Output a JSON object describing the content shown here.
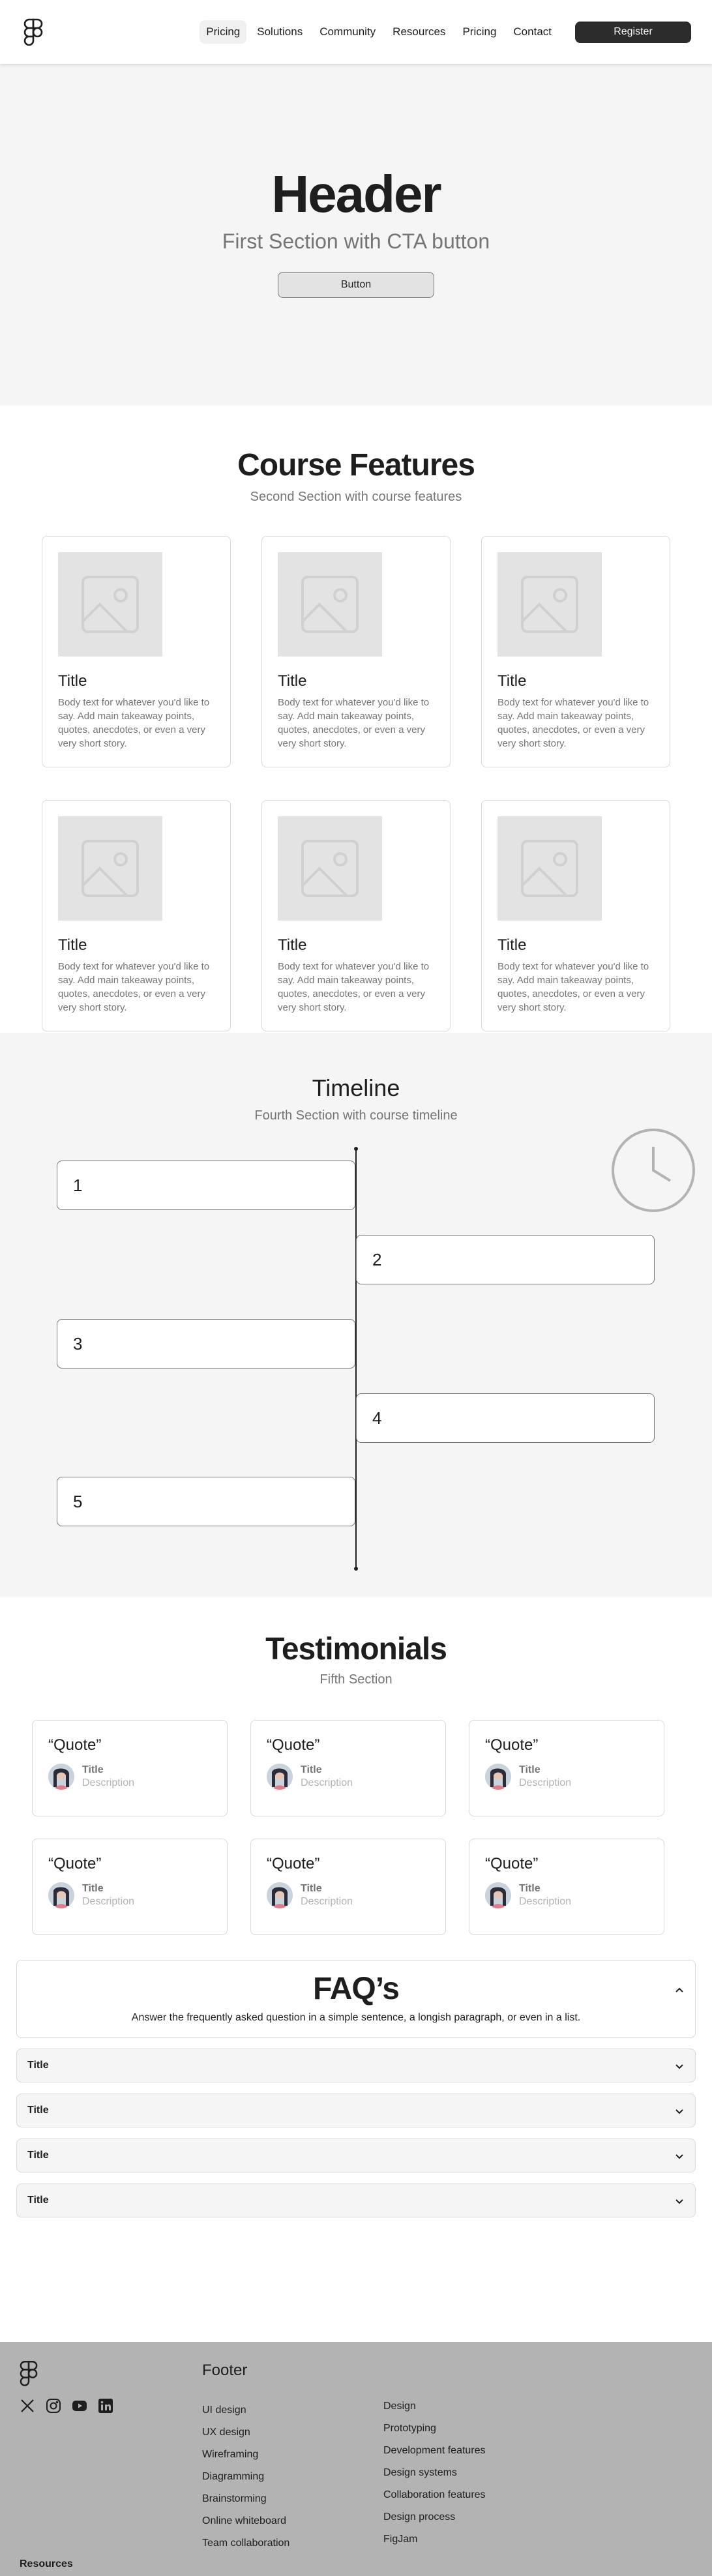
{
  "nav": {
    "links": [
      "Pricing",
      "Solutions",
      "Community",
      "Resources",
      "Pricing",
      "Contact"
    ],
    "register_label": "Register"
  },
  "hero": {
    "title": "Header",
    "subtitle": "First Section with CTA button",
    "button_label": "Button"
  },
  "features": {
    "title": "Course Features",
    "subtitle": "Second Section with course features",
    "cards": [
      {
        "title": "Title",
        "body": "Body text for whatever you'd like to say. Add main takeaway points, quotes, anecdotes, or even a very very short story."
      },
      {
        "title": "Title",
        "body": "Body text for whatever you'd like to say. Add main takeaway points, quotes, anecdotes, or even a very very short story."
      },
      {
        "title": "Title",
        "body": "Body text for whatever you'd like to say. Add main takeaway points, quotes, anecdotes, or even a very very short story."
      },
      {
        "title": "Title",
        "body": "Body text for whatever you'd like to say. Add main takeaway points, quotes, anecdotes, or even a very very short story."
      },
      {
        "title": "Title",
        "body": "Body text for whatever you'd like to say. Add main takeaway points, quotes, anecdotes, or even a very very short story."
      },
      {
        "title": "Title",
        "body": "Body text for whatever you'd like to say. Add main takeaway points, quotes, anecdotes, or even a very very short story."
      }
    ]
  },
  "timeline": {
    "title": "Timeline",
    "subtitle": "Fourth Section with course timeline",
    "items": [
      "1",
      "2",
      "3",
      "4",
      "5"
    ]
  },
  "testimonials": {
    "title": "Testimonials",
    "subtitle": "Fifth Section",
    "cards": [
      {
        "quote": "“Quote”",
        "title": "Title",
        "description": "Description"
      },
      {
        "quote": "“Quote”",
        "title": "Title",
        "description": "Description"
      },
      {
        "quote": "“Quote”",
        "title": "Title",
        "description": "Description"
      },
      {
        "quote": "“Quote”",
        "title": "Title",
        "description": "Description"
      },
      {
        "quote": "“Quote”",
        "title": "Title",
        "description": "Description"
      },
      {
        "quote": "“Quote”",
        "title": "Title",
        "description": "Description"
      }
    ]
  },
  "faq": {
    "title": "FAQ’s",
    "description": "Answer the frequently asked question in a simple sentence, a longish paragraph, or even in a list.",
    "items": [
      "Title",
      "Title",
      "Title",
      "Title"
    ]
  },
  "footer": {
    "title": "Footer",
    "social_icons": [
      "x-icon",
      "instagram-icon",
      "youtube-icon",
      "linkedin-icon"
    ],
    "col1": [
      "UI design",
      "UX design",
      "Wireframing",
      "Diagramming",
      "Brainstorming",
      "Online whiteboard",
      "Team collaboration"
    ],
    "col2": [
      "Design",
      "Prototyping",
      "Development features",
      "Design systems",
      "Collaboration features",
      "Design process",
      "FigJam"
    ],
    "resources_label": "Resources"
  },
  "colors": {
    "primary_dark": "#2c2c2c",
    "section_gray": "#f5f5f5",
    "footer_gray": "#b3b3b3",
    "muted_text": "#757575"
  }
}
